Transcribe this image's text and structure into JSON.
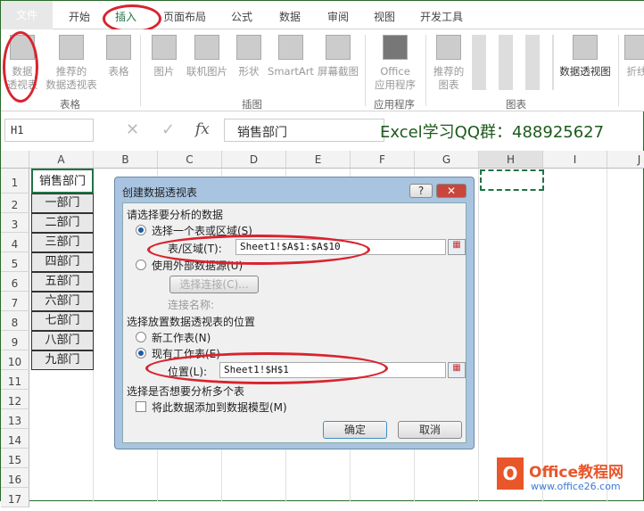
{
  "tabs": [
    "文件",
    "开始",
    "插入",
    "页面布局",
    "公式",
    "数据",
    "审阅",
    "视图",
    "开发工具"
  ],
  "ribbon": {
    "pivot": "数据\n透视表",
    "rec_pivot": "推荐的\n数据透视表",
    "table": "表格",
    "group_table": "表格",
    "picture": "图片",
    "online_picture": "联机图片",
    "shapes": "形状",
    "smartart": "SmartArt",
    "screenshot": "屏幕截图",
    "group_illus": "插图",
    "office_apps": "Office\n应用程序",
    "group_apps": "应用程序",
    "rec_charts": "推荐的\n图表",
    "pivot_chart": "数据透视图",
    "group_charts": "图表",
    "line": "折线"
  },
  "formula_bar": {
    "name_box": "H1",
    "formula": "销售部门",
    "fx": "fx",
    "cancel": "✕",
    "enter": "✓"
  },
  "watermark": "Excel学习QQ群：488925627",
  "columns": [
    "A",
    "B",
    "C",
    "D",
    "E",
    "F",
    "G",
    "H",
    "I",
    "J"
  ],
  "rows": [
    "1",
    "2",
    "3",
    "4",
    "5",
    "6",
    "7",
    "8",
    "9",
    "10",
    "11",
    "12",
    "13",
    "14",
    "15",
    "16",
    "17"
  ],
  "cells": [
    "销售部门",
    "一部门",
    "二部门",
    "三部门",
    "四部门",
    "五部门",
    "六部门",
    "七部门",
    "八部门",
    "九部门"
  ],
  "dialog": {
    "title": "创建数据透视表",
    "help": "?",
    "close": "✕",
    "section1": "请选择要分析的数据",
    "opt_range": "选择一个表或区域(S)",
    "range_label": "表/区域(T):",
    "range_value": "Sheet1!$A$1:$A$10",
    "opt_external": "使用外部数据源(U)",
    "choose_conn": "选择连接(C)...",
    "conn_name": "连接名称:",
    "section2": "选择放置数据透视表的位置",
    "opt_new": "新工作表(N)",
    "opt_existing": "现有工作表(E)",
    "loc_label": "位置(L):",
    "loc_value": "Sheet1!$H$1",
    "section3": "选择是否想要分析多个表",
    "add_model": "将此数据添加到数据模型(M)",
    "ok": "确定",
    "cancel": "取消"
  },
  "logo": {
    "name": "Office教程网",
    "url": "www.office26.com"
  }
}
